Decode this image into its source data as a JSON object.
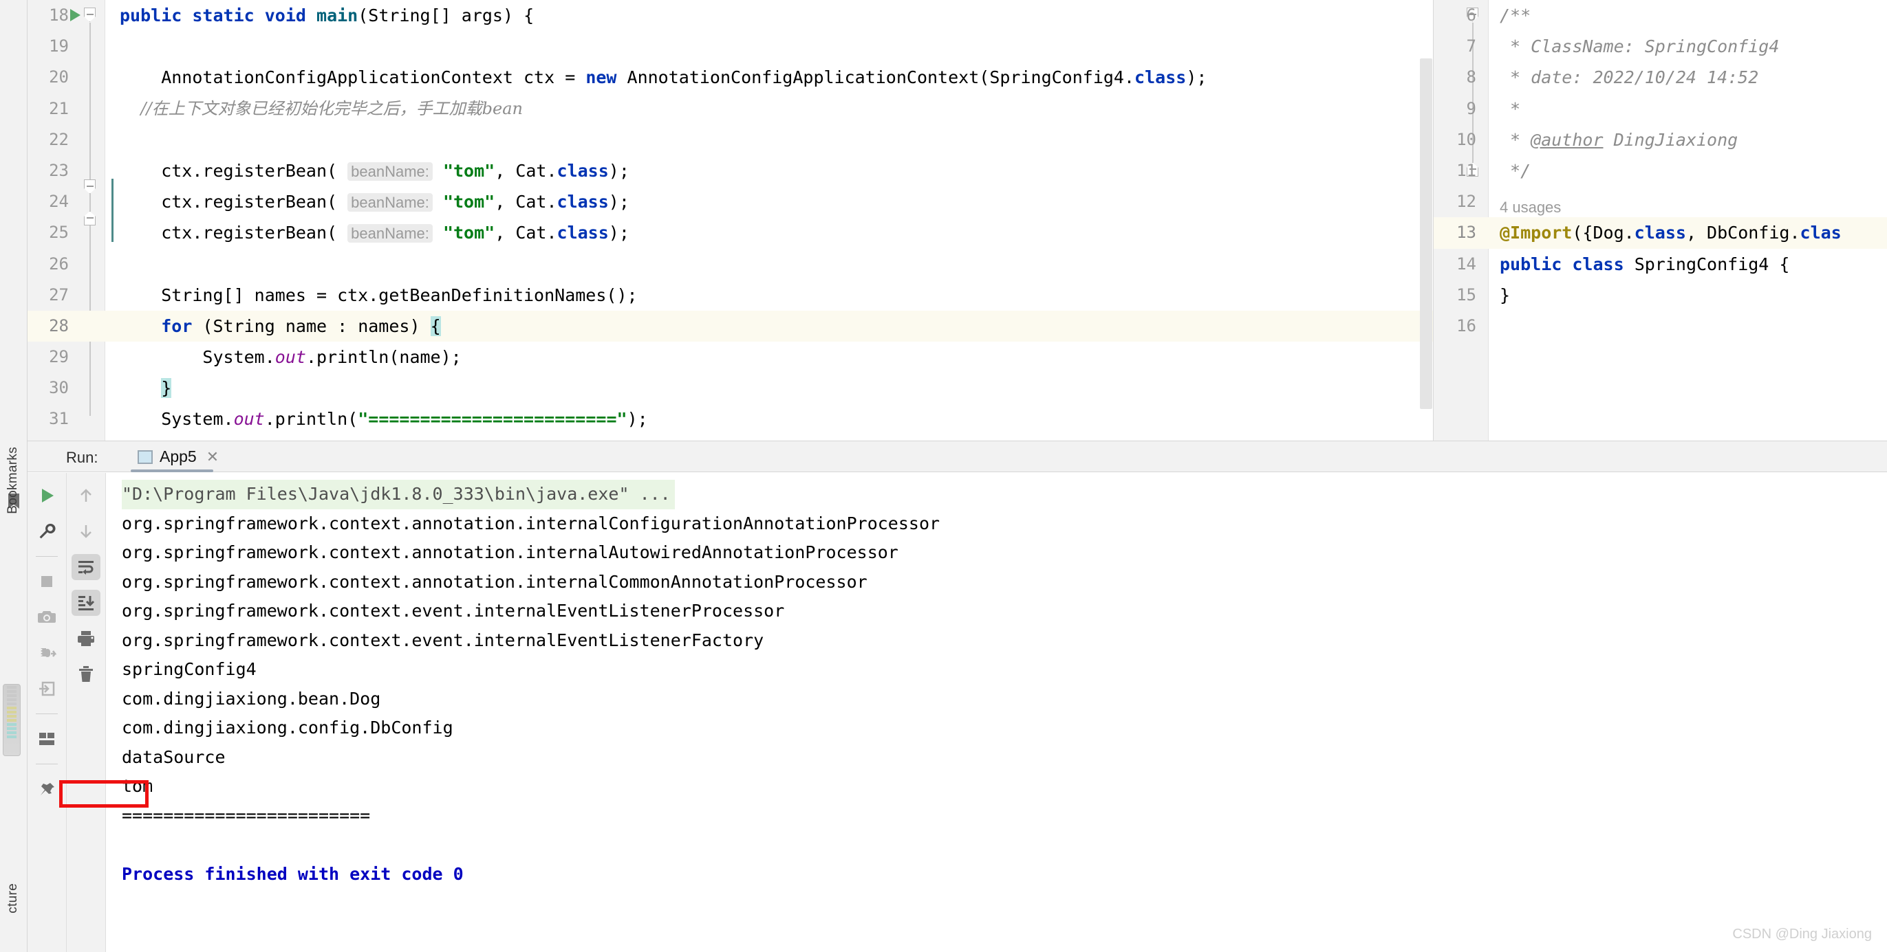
{
  "editor": {
    "left_pane": {
      "first_line": 18,
      "highlighted_line": 28,
      "lines": [
        {
          "n": "18",
          "text": "public static void main(String[] args) {"
        },
        {
          "n": "19",
          "text": ""
        },
        {
          "n": "20",
          "text": "    AnnotationConfigApplicationContext ctx = new AnnotationConfigApplicationContext(SpringConfig4.class);"
        },
        {
          "n": "21",
          "text": "    //在上下文对象已经初始化完毕之后，手工加载bean"
        },
        {
          "n": "22",
          "text": ""
        },
        {
          "n": "23",
          "text": "    ctx.registerBean( beanName: \"tom\", Cat.class);"
        },
        {
          "n": "24",
          "text": "    ctx.registerBean( beanName: \"tom\", Cat.class);"
        },
        {
          "n": "25",
          "text": "    ctx.registerBean( beanName: \"tom\", Cat.class);"
        },
        {
          "n": "26",
          "text": ""
        },
        {
          "n": "27",
          "text": "    String[] names = ctx.getBeanDefinitionNames();"
        },
        {
          "n": "28",
          "text": "    for (String name : names) {"
        },
        {
          "n": "29",
          "text": "        System.out.println(name);"
        },
        {
          "n": "30",
          "text": "    }"
        },
        {
          "n": "31",
          "text": "    System.out.println(\"========================\");"
        }
      ],
      "param_hint": "beanName:",
      "bean_name_value": "\"tom\"",
      "separator_string": "========================"
    },
    "right_pane": {
      "first_line": 6,
      "highlighted_line": 13,
      "usages_label": "4 usages",
      "lines": [
        {
          "n": "6",
          "text": "/**"
        },
        {
          "n": "7",
          "text": " * ClassName: SpringConfig4"
        },
        {
          "n": "8",
          "text": " * date: 2022/10/24 14:52"
        },
        {
          "n": "9",
          "text": " *"
        },
        {
          "n": "10",
          "text": " * @author DingJiaxiong"
        },
        {
          "n": "11",
          "text": " */"
        },
        {
          "n": "12",
          "text": ""
        },
        {
          "n": "13",
          "text": "@Import({Dog.class, DbConfig.class"
        },
        {
          "n": "14",
          "text": "public class SpringConfig4 {"
        },
        {
          "n": "15",
          "text": "}"
        },
        {
          "n": "16",
          "text": ""
        }
      ],
      "javadoc": {
        "class_name": "ClassName: SpringConfig4",
        "date": "date: 2022/10/24 14:52",
        "author_tag": "@author",
        "author_name": "DingJiaxiong"
      },
      "import_annotation": "@Import({Dog.class, DbConfig.clas",
      "class_decl": "public class SpringConfig4 {",
      "class_close": "}"
    }
  },
  "run_window": {
    "label": "Run:",
    "tab_name": "App5",
    "tab_close": "✕",
    "toolbar_left": [
      {
        "name": "rerun-button",
        "icon": "play-icon"
      },
      {
        "name": "edit-configurations-button",
        "icon": "wrench-icon"
      },
      {
        "name": "stop-button",
        "icon": "stop-square-icon"
      },
      {
        "name": "screenshot-button",
        "icon": "camera-icon"
      },
      {
        "name": "dump-threads-button",
        "icon": "bug-arrow-icon"
      },
      {
        "name": "attach-button",
        "icon": "login-arrow-icon"
      },
      {
        "name": "layout-button",
        "icon": "layout-icon"
      }
    ],
    "toolbar_right": [
      {
        "name": "up-stack-button",
        "icon": "arrow-up-icon"
      },
      {
        "name": "down-stack-button",
        "icon": "arrow-down-icon"
      },
      {
        "name": "soft-wrap-button",
        "icon": "soft-wrap-icon",
        "pressed": true
      },
      {
        "name": "scroll-to-end-button",
        "icon": "scroll-to-end-icon",
        "pressed": true
      },
      {
        "name": "print-button",
        "icon": "printer-icon"
      },
      {
        "name": "clear-all-button",
        "icon": "trash-icon"
      }
    ],
    "console": [
      {
        "text": "\"D:\\Program Files\\Java\\jdk1.8.0_333\\bin\\java.exe\" ...",
        "style": "cmd"
      },
      {
        "text": "org.springframework.context.annotation.internalConfigurationAnnotationProcessor",
        "style": "normal"
      },
      {
        "text": "org.springframework.context.annotation.internalAutowiredAnnotationProcessor",
        "style": "normal"
      },
      {
        "text": "org.springframework.context.annotation.internalCommonAnnotationProcessor",
        "style": "normal"
      },
      {
        "text": "org.springframework.context.event.internalEventListenerProcessor",
        "style": "normal"
      },
      {
        "text": "org.springframework.context.event.internalEventListenerFactory",
        "style": "normal"
      },
      {
        "text": "springConfig4",
        "style": "normal"
      },
      {
        "text": "com.dingjiaxiong.bean.Dog",
        "style": "normal"
      },
      {
        "text": "com.dingjiaxiong.config.DbConfig",
        "style": "normal"
      },
      {
        "text": "dataSource",
        "style": "normal"
      },
      {
        "text": "tom",
        "style": "normal"
      },
      {
        "text": "========================",
        "style": "normal"
      },
      {
        "text": "",
        "style": "blank"
      },
      {
        "text": "Process finished with exit code 0",
        "style": "exit"
      }
    ],
    "highlight_annotation": {
      "target_text": "tom",
      "color": "#ee1111"
    }
  },
  "left_stripe": {
    "bookmarks_label": "Bookmarks",
    "structure_label": "cture"
  },
  "watermark": "CSDN @Ding Jiaxiong",
  "colors": {
    "keyword": "#0033b3",
    "string": "#067d17",
    "comment": "#8c8c8c",
    "field": "#871094",
    "annotation": "#9e880d",
    "highlight_line": "#fcfaef",
    "console_cmd_bg": "#e9f5e4",
    "exit_text": "#0000c0",
    "accent_red": "#ee1111"
  }
}
